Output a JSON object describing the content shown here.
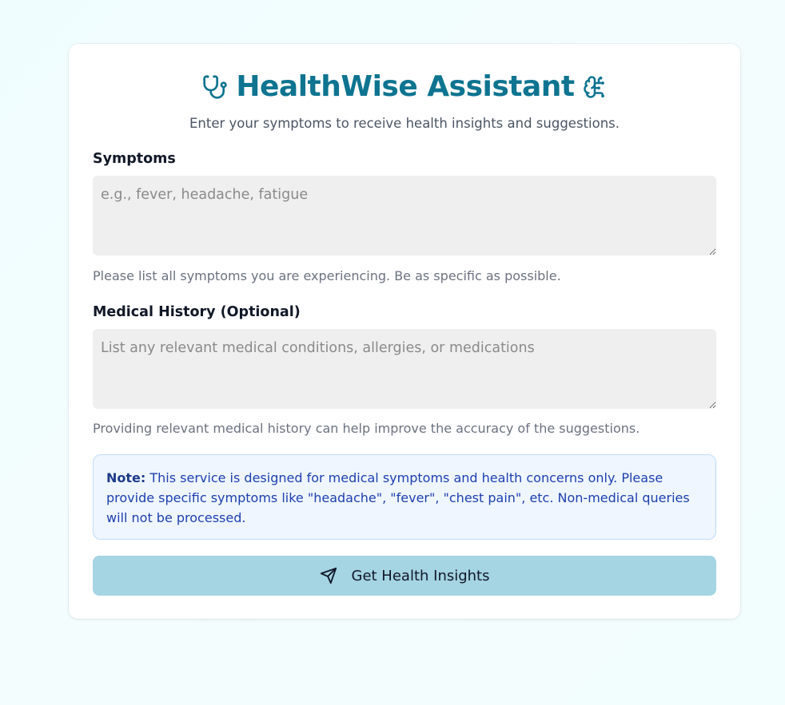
{
  "header": {
    "title": "HealthWise Assistant",
    "subtitle": "Enter your symptoms to receive health insights and suggestions.",
    "left_icon": "stethoscope-icon",
    "right_icon": "brain-icon"
  },
  "symptoms": {
    "label": "Symptoms",
    "placeholder": "e.g., fever, headache, fatigue",
    "value": "",
    "hint": "Please list all symptoms you are experiencing. Be as specific as possible."
  },
  "history": {
    "label": "Medical History (Optional)",
    "placeholder": "List any relevant medical conditions, allergies, or medications",
    "value": "",
    "hint": "Providing relevant medical history can help improve the accuracy of the suggestions."
  },
  "note": {
    "prefix": "Note:",
    "text": " This service is designed for medical symptoms and health concerns only. Please provide specific symptoms like \"headache\", \"fever\", \"chest pain\", etc. Non-medical queries will not be processed."
  },
  "submit": {
    "label": "Get Health Insights",
    "icon": "send-icon"
  },
  "colors": {
    "accent": "#0e7490",
    "button_bg": "#a5d4e2",
    "note_bg": "#eff6ff",
    "note_text": "#1e40af",
    "input_bg": "#efefef"
  }
}
